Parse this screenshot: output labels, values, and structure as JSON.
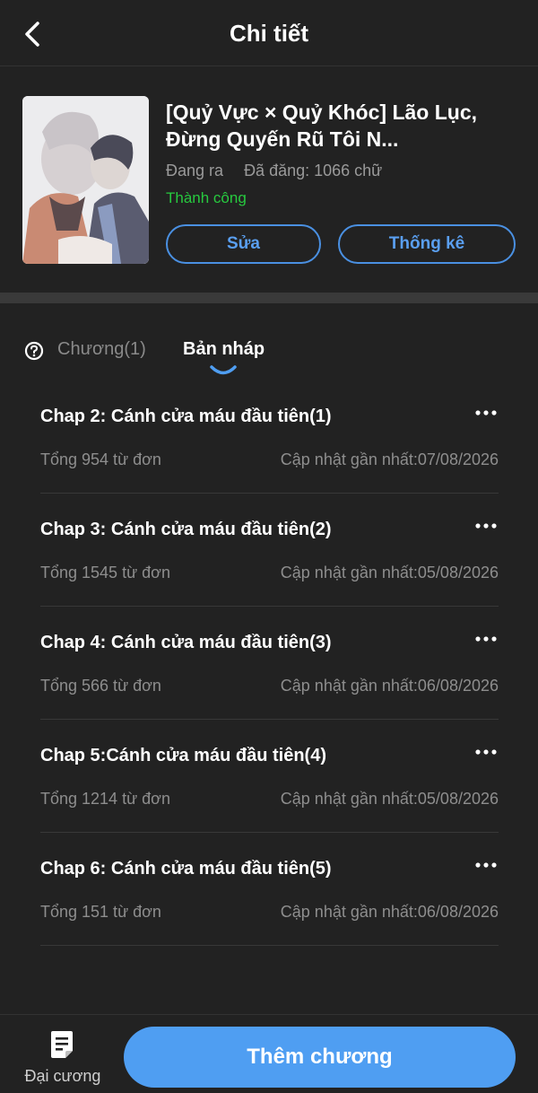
{
  "header": {
    "title": "Chi tiết"
  },
  "book": {
    "title": "[Quỷ Vực × Quỷ Khóc] Lão Lục, Đừng Quyến Rũ Tôi N...",
    "status": "Đang ra",
    "published": "Đã đăng: 1066 chữ",
    "result": "Thành công",
    "edit_label": "Sửa",
    "stats_label": "Thống kê"
  },
  "tabs": {
    "chapters": "Chương(1)",
    "drafts": "Bản nháp"
  },
  "drafts": [
    {
      "title": "Chap 2: Cánh cửa máu đầu tiên(1)",
      "count": "Tổng 954 từ đơn",
      "updated": "Cập nhật gần nhất:07/08/2026"
    },
    {
      "title": "Chap 3: Cánh cửa máu đầu tiên(2)",
      "count": "Tổng 1545 từ đơn",
      "updated": "Cập nhật gần nhất:05/08/2026"
    },
    {
      "title": "Chap 4: Cánh cửa máu đầu tiên(3)",
      "count": "Tổng 566 từ đơn",
      "updated": "Cập nhật gần nhất:06/08/2026"
    },
    {
      "title": "Chap 5:Cánh cửa máu đầu tiên(4)",
      "count": "Tổng 1214 từ đơn",
      "updated": "Cập nhật gần nhất:05/08/2026"
    },
    {
      "title": "Chap 6: Cánh cửa máu đầu tiên(5)",
      "count": "Tổng 151 từ đơn",
      "updated": "Cập nhật gần nhất:06/08/2026"
    }
  ],
  "bottom": {
    "outline_label": "Đại cương",
    "add_chapter_label": "Thêm chương"
  },
  "colors": {
    "accent": "#4f9ef2",
    "success": "#27c93f",
    "background": "#222222"
  }
}
